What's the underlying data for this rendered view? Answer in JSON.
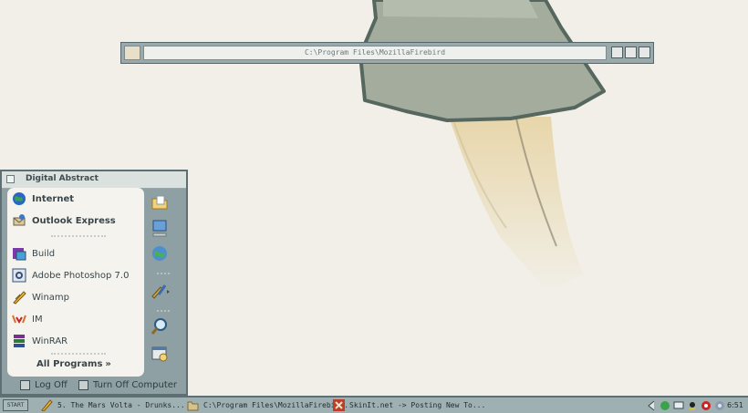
{
  "address_window": {
    "path": "C:\\Program Files\\MozillaFirebird",
    "icon": "folder-icon"
  },
  "start_menu": {
    "title": "Digital Abstract",
    "pinned": [
      {
        "label": "Internet",
        "icon": "globe-icon"
      },
      {
        "label": "Outlook Express",
        "icon": "outlook-express-icon"
      }
    ],
    "recent": [
      {
        "label": "Build",
        "icon": "build-icon"
      },
      {
        "label": "Adobe Photoshop 7.0",
        "icon": "photoshop-icon"
      },
      {
        "label": "Winamp",
        "icon": "winamp-icon"
      },
      {
        "label": "IM",
        "icon": "im-icon"
      },
      {
        "label": "WinRAR",
        "icon": "winrar-icon"
      }
    ],
    "all_programs": "All Programs",
    "right_icons": [
      "my-documents-icon",
      "my-computer-icon",
      "network-icon",
      "control-panel-icon",
      "search-icon",
      "run-icon"
    ],
    "log_off": "Log Off",
    "turn_off": "Turn Off Computer"
  },
  "taskbar": {
    "start_label": "START",
    "tasks": [
      {
        "label": "5. The Mars Volta - Drunks...",
        "icon": "winamp-icon"
      },
      {
        "label": "C:\\Program Files\\MozillaFirebi...",
        "icon": "folder-icon"
      },
      {
        "label": "SkinIt.net -> Posting New To...",
        "icon": "browser-icon"
      }
    ],
    "clock": "6:51"
  },
  "colors": {
    "desktop": "#f1efe7",
    "chrome": "#8ea0a3",
    "chrome_dark": "#5d6f73",
    "panel": "#f4f3ee"
  }
}
